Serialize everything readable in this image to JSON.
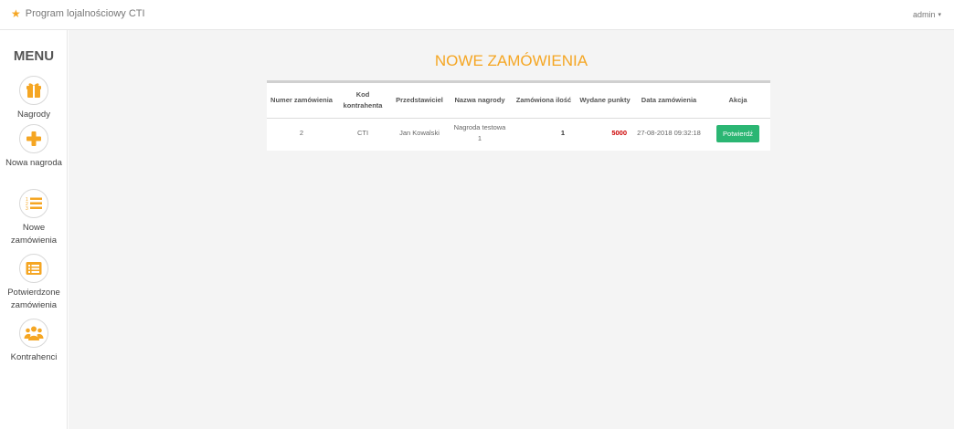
{
  "navbar": {
    "brand": "Program lojalnościowy CTI",
    "user": "admin"
  },
  "sidebar": {
    "title": "MENU",
    "items": [
      {
        "label": "Nagrody",
        "icon": "gift-icon"
      },
      {
        "label": "Nowa nagroda",
        "icon": "plus-icon"
      },
      {
        "label": "Nowe zamówienia",
        "icon": "numbered-list-icon"
      },
      {
        "label": "Potwierdzone zamówienia",
        "icon": "list-card-icon"
      },
      {
        "label": "Kontrahenci",
        "icon": "users-icon"
      }
    ]
  },
  "main": {
    "title": "NOWE ZAMÓWIENIA",
    "table": {
      "headers": [
        "Numer zamówienia",
        "Kod kontrahenta",
        "Przedstawiciel",
        "Nazwa nagrody",
        "Zamówiona ilość",
        "Wydane punkty",
        "Data zamówienia",
        "Akcja"
      ],
      "rows": [
        {
          "number": "2",
          "contractor_code": "CTI",
          "representative": "Jan Kowalski",
          "reward_name": "Nagroda testowa 1",
          "quantity": "1",
          "points": "5000",
          "date": "27-08-2018 09:32:18",
          "action": "Potwierdź"
        }
      ]
    }
  },
  "colors": {
    "accent": "#f5a623",
    "points": "#cc0000",
    "confirm": "#2bb673"
  }
}
